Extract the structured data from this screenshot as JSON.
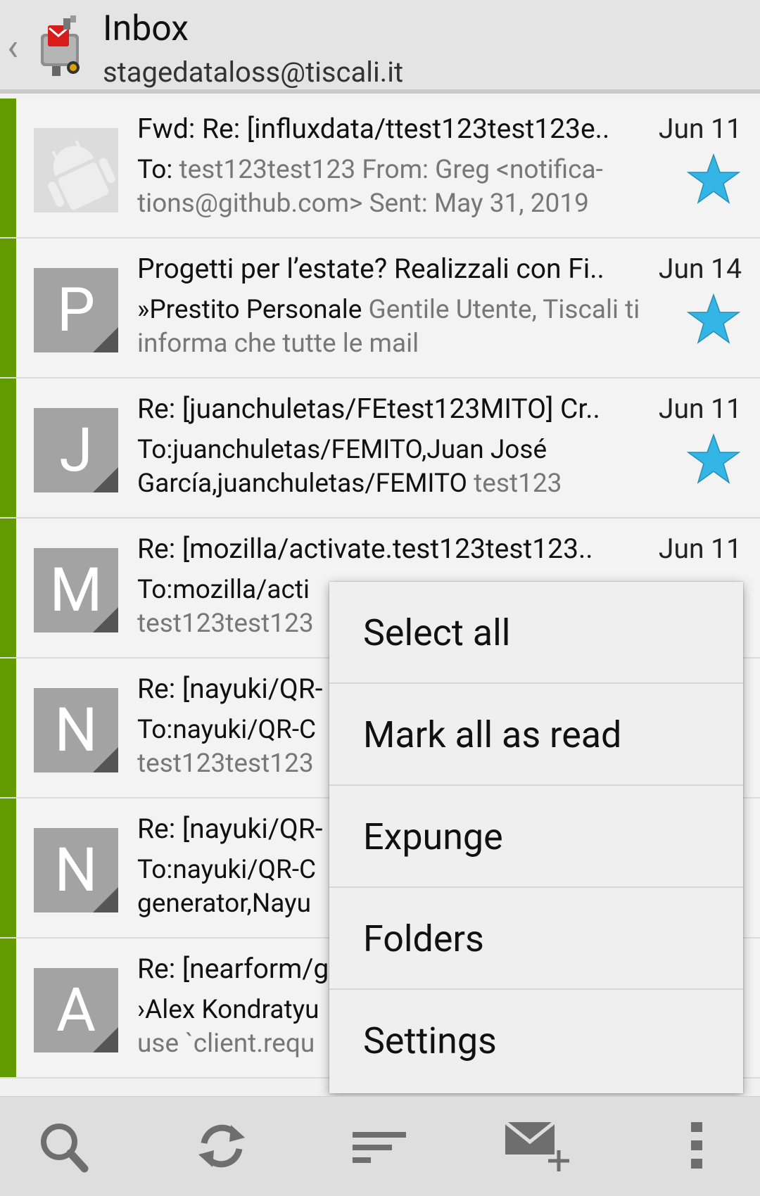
{
  "header": {
    "back_glyph": "‹",
    "title": "Inbox",
    "account": "stagedataloss@tiscali.it"
  },
  "messages": [
    {
      "avatar_letter": "",
      "subject": "Fwd: Re: [influxdata/ttest123test123e..",
      "date": "Jun 11",
      "from": "To: ",
      "preview": "test123test123 From: Greg <notifica-tions@github.com> Sent: May 31, 2019",
      "starred": true
    },
    {
      "avatar_letter": "P",
      "subject": "Progetti per l’estate? Realizzali con Fi..",
      "date": "Jun 14",
      "from": "»Prestito Personale ",
      "preview": "Gentile Utente, Tiscali ti informa che tutte le mail",
      "starred": true
    },
    {
      "avatar_letter": "J",
      "subject": "Re: [juanchuletas/FEtest123MITO] Cr..",
      "date": "Jun 11",
      "from": "To:juanchuletas/FEMITO,Juan José García,juanchuletas/FEMITO ",
      "preview": "test123",
      "starred": true
    },
    {
      "avatar_letter": "M",
      "subject": "Re: [mozilla/activate.test123test123..",
      "date": "Jun 11",
      "from": "To:mozilla/acti",
      "preview": "test123test123",
      "starred": false
    },
    {
      "avatar_letter": "N",
      "subject": "Re: [nayuki/QR-",
      "date": "",
      "from": "To:nayuki/QR-C",
      "preview": "test123test123",
      "starred": false
    },
    {
      "avatar_letter": "N",
      "subject": "Re: [nayuki/QR-",
      "date": "",
      "from": "To:nayuki/QR-C generator,Nayu",
      "preview": "",
      "starred": false
    },
    {
      "avatar_letter": "A",
      "subject": "Re: [nearform/g",
      "date": "",
      "from": "›Alex Kondratyu",
      "preview": "use `client.requ",
      "starred": false
    }
  ],
  "menu": {
    "items": [
      "Select all",
      "Mark all as read",
      "Expunge",
      "Folders",
      "Settings"
    ]
  },
  "bottom_bar": {
    "buttons": [
      "search-icon",
      "refresh-icon",
      "sort-icon",
      "compose-icon",
      "overflow-menu-icon"
    ]
  },
  "colors": {
    "accent_bar": "#629b00",
    "star": "#33b5e5",
    "avatar": "#a3a3a3"
  }
}
